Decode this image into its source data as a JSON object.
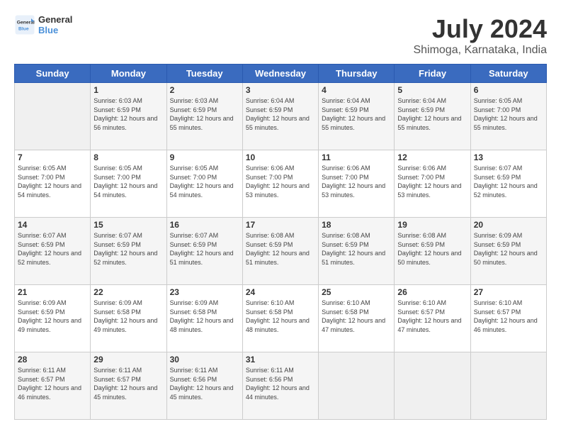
{
  "logo": {
    "line1": "General",
    "line2": "Blue"
  },
  "title": "July 2024",
  "subtitle": "Shimoga, Karnataka, India",
  "days_of_week": [
    "Sunday",
    "Monday",
    "Tuesday",
    "Wednesday",
    "Thursday",
    "Friday",
    "Saturday"
  ],
  "weeks": [
    [
      {
        "day": "",
        "sunrise": "",
        "sunset": "",
        "daylight": "",
        "empty": true
      },
      {
        "day": "1",
        "sunrise": "Sunrise: 6:03 AM",
        "sunset": "Sunset: 6:59 PM",
        "daylight": "Daylight: 12 hours and 56 minutes."
      },
      {
        "day": "2",
        "sunrise": "Sunrise: 6:03 AM",
        "sunset": "Sunset: 6:59 PM",
        "daylight": "Daylight: 12 hours and 55 minutes."
      },
      {
        "day": "3",
        "sunrise": "Sunrise: 6:04 AM",
        "sunset": "Sunset: 6:59 PM",
        "daylight": "Daylight: 12 hours and 55 minutes."
      },
      {
        "day": "4",
        "sunrise": "Sunrise: 6:04 AM",
        "sunset": "Sunset: 6:59 PM",
        "daylight": "Daylight: 12 hours and 55 minutes."
      },
      {
        "day": "5",
        "sunrise": "Sunrise: 6:04 AM",
        "sunset": "Sunset: 6:59 PM",
        "daylight": "Daylight: 12 hours and 55 minutes."
      },
      {
        "day": "6",
        "sunrise": "Sunrise: 6:05 AM",
        "sunset": "Sunset: 7:00 PM",
        "daylight": "Daylight: 12 hours and 55 minutes."
      }
    ],
    [
      {
        "day": "7",
        "sunrise": "Sunrise: 6:05 AM",
        "sunset": "Sunset: 7:00 PM",
        "daylight": "Daylight: 12 hours and 54 minutes."
      },
      {
        "day": "8",
        "sunrise": "Sunrise: 6:05 AM",
        "sunset": "Sunset: 7:00 PM",
        "daylight": "Daylight: 12 hours and 54 minutes."
      },
      {
        "day": "9",
        "sunrise": "Sunrise: 6:05 AM",
        "sunset": "Sunset: 7:00 PM",
        "daylight": "Daylight: 12 hours and 54 minutes."
      },
      {
        "day": "10",
        "sunrise": "Sunrise: 6:06 AM",
        "sunset": "Sunset: 7:00 PM",
        "daylight": "Daylight: 12 hours and 53 minutes."
      },
      {
        "day": "11",
        "sunrise": "Sunrise: 6:06 AM",
        "sunset": "Sunset: 7:00 PM",
        "daylight": "Daylight: 12 hours and 53 minutes."
      },
      {
        "day": "12",
        "sunrise": "Sunrise: 6:06 AM",
        "sunset": "Sunset: 7:00 PM",
        "daylight": "Daylight: 12 hours and 53 minutes."
      },
      {
        "day": "13",
        "sunrise": "Sunrise: 6:07 AM",
        "sunset": "Sunset: 6:59 PM",
        "daylight": "Daylight: 12 hours and 52 minutes."
      }
    ],
    [
      {
        "day": "14",
        "sunrise": "Sunrise: 6:07 AM",
        "sunset": "Sunset: 6:59 PM",
        "daylight": "Daylight: 12 hours and 52 minutes."
      },
      {
        "day": "15",
        "sunrise": "Sunrise: 6:07 AM",
        "sunset": "Sunset: 6:59 PM",
        "daylight": "Daylight: 12 hours and 52 minutes."
      },
      {
        "day": "16",
        "sunrise": "Sunrise: 6:07 AM",
        "sunset": "Sunset: 6:59 PM",
        "daylight": "Daylight: 12 hours and 51 minutes."
      },
      {
        "day": "17",
        "sunrise": "Sunrise: 6:08 AM",
        "sunset": "Sunset: 6:59 PM",
        "daylight": "Daylight: 12 hours and 51 minutes."
      },
      {
        "day": "18",
        "sunrise": "Sunrise: 6:08 AM",
        "sunset": "Sunset: 6:59 PM",
        "daylight": "Daylight: 12 hours and 51 minutes."
      },
      {
        "day": "19",
        "sunrise": "Sunrise: 6:08 AM",
        "sunset": "Sunset: 6:59 PM",
        "daylight": "Daylight: 12 hours and 50 minutes."
      },
      {
        "day": "20",
        "sunrise": "Sunrise: 6:09 AM",
        "sunset": "Sunset: 6:59 PM",
        "daylight": "Daylight: 12 hours and 50 minutes."
      }
    ],
    [
      {
        "day": "21",
        "sunrise": "Sunrise: 6:09 AM",
        "sunset": "Sunset: 6:59 PM",
        "daylight": "Daylight: 12 hours and 49 minutes."
      },
      {
        "day": "22",
        "sunrise": "Sunrise: 6:09 AM",
        "sunset": "Sunset: 6:58 PM",
        "daylight": "Daylight: 12 hours and 49 minutes."
      },
      {
        "day": "23",
        "sunrise": "Sunrise: 6:09 AM",
        "sunset": "Sunset: 6:58 PM",
        "daylight": "Daylight: 12 hours and 48 minutes."
      },
      {
        "day": "24",
        "sunrise": "Sunrise: 6:10 AM",
        "sunset": "Sunset: 6:58 PM",
        "daylight": "Daylight: 12 hours and 48 minutes."
      },
      {
        "day": "25",
        "sunrise": "Sunrise: 6:10 AM",
        "sunset": "Sunset: 6:58 PM",
        "daylight": "Daylight: 12 hours and 47 minutes."
      },
      {
        "day": "26",
        "sunrise": "Sunrise: 6:10 AM",
        "sunset": "Sunset: 6:57 PM",
        "daylight": "Daylight: 12 hours and 47 minutes."
      },
      {
        "day": "27",
        "sunrise": "Sunrise: 6:10 AM",
        "sunset": "Sunset: 6:57 PM",
        "daylight": "Daylight: 12 hours and 46 minutes."
      }
    ],
    [
      {
        "day": "28",
        "sunrise": "Sunrise: 6:11 AM",
        "sunset": "Sunset: 6:57 PM",
        "daylight": "Daylight: 12 hours and 46 minutes."
      },
      {
        "day": "29",
        "sunrise": "Sunrise: 6:11 AM",
        "sunset": "Sunset: 6:57 PM",
        "daylight": "Daylight: 12 hours and 45 minutes."
      },
      {
        "day": "30",
        "sunrise": "Sunrise: 6:11 AM",
        "sunset": "Sunset: 6:56 PM",
        "daylight": "Daylight: 12 hours and 45 minutes."
      },
      {
        "day": "31",
        "sunrise": "Sunrise: 6:11 AM",
        "sunset": "Sunset: 6:56 PM",
        "daylight": "Daylight: 12 hours and 44 minutes."
      },
      {
        "day": "",
        "sunrise": "",
        "sunset": "",
        "daylight": "",
        "empty": true
      },
      {
        "day": "",
        "sunrise": "",
        "sunset": "",
        "daylight": "",
        "empty": true
      },
      {
        "day": "",
        "sunrise": "",
        "sunset": "",
        "daylight": "",
        "empty": true
      }
    ]
  ]
}
